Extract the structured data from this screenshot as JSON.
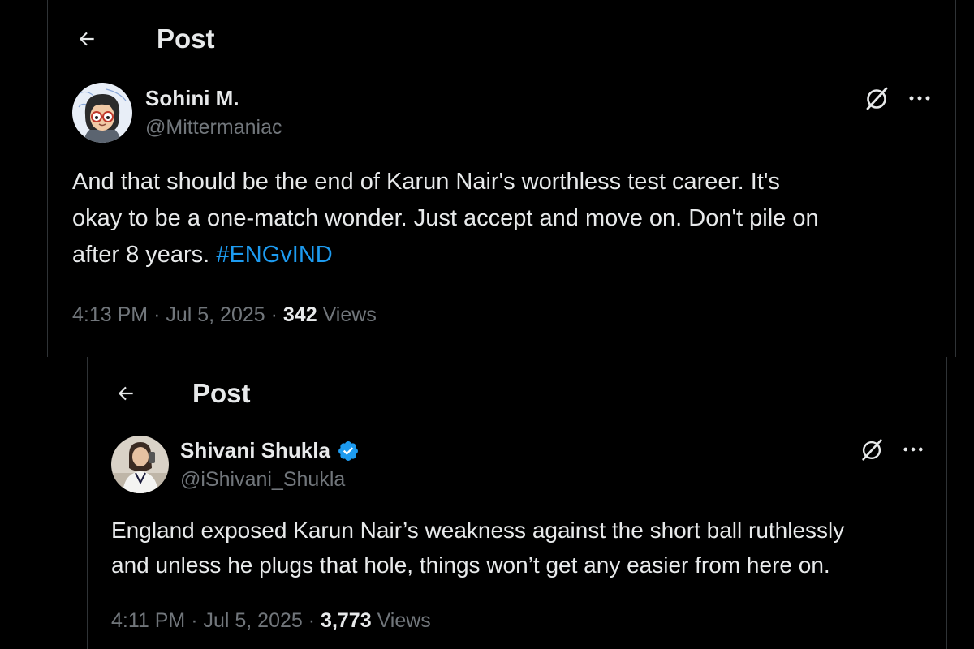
{
  "post1": {
    "header_title": "Post",
    "author": {
      "display_name": "Sohini M.",
      "handle": "@Mittermaniac"
    },
    "text_lines": [
      "And that should be the end of Karun Nair's worthless test career. It's",
      "okay to be a one-match wonder. Just accept and move on. Don't pile on",
      "after 8 years. "
    ],
    "hashtag": "#ENGvIND",
    "time": "4:13 PM",
    "date": "Jul 5, 2025",
    "views_count": "342",
    "views_label": "Views"
  },
  "post2": {
    "header_title": "Post",
    "author": {
      "display_name": "Shivani Shukla",
      "handle": "@iShivani_Shukla",
      "verified": true
    },
    "text_lines": [
      "England exposed Karun Nair’s weakness against the short ball ruthlessly",
      "and unless he plugs that hole, things won’t get any easier from here on."
    ],
    "time": "4:11 PM",
    "date": "Jul 5, 2025",
    "views_count": "3,773",
    "views_label": "Views"
  },
  "meta_separator": "·",
  "icons": {
    "back": "back-arrow-icon",
    "grok": "grok-icon",
    "more": "more-options-icon",
    "verified": "verified-badge-icon"
  },
  "colors": {
    "background": "#000000",
    "text_primary": "#e7e9ea",
    "text_secondary": "#71767b",
    "link": "#1d9bf0",
    "verified": "#1d9bf0",
    "border": "#2f3336"
  }
}
